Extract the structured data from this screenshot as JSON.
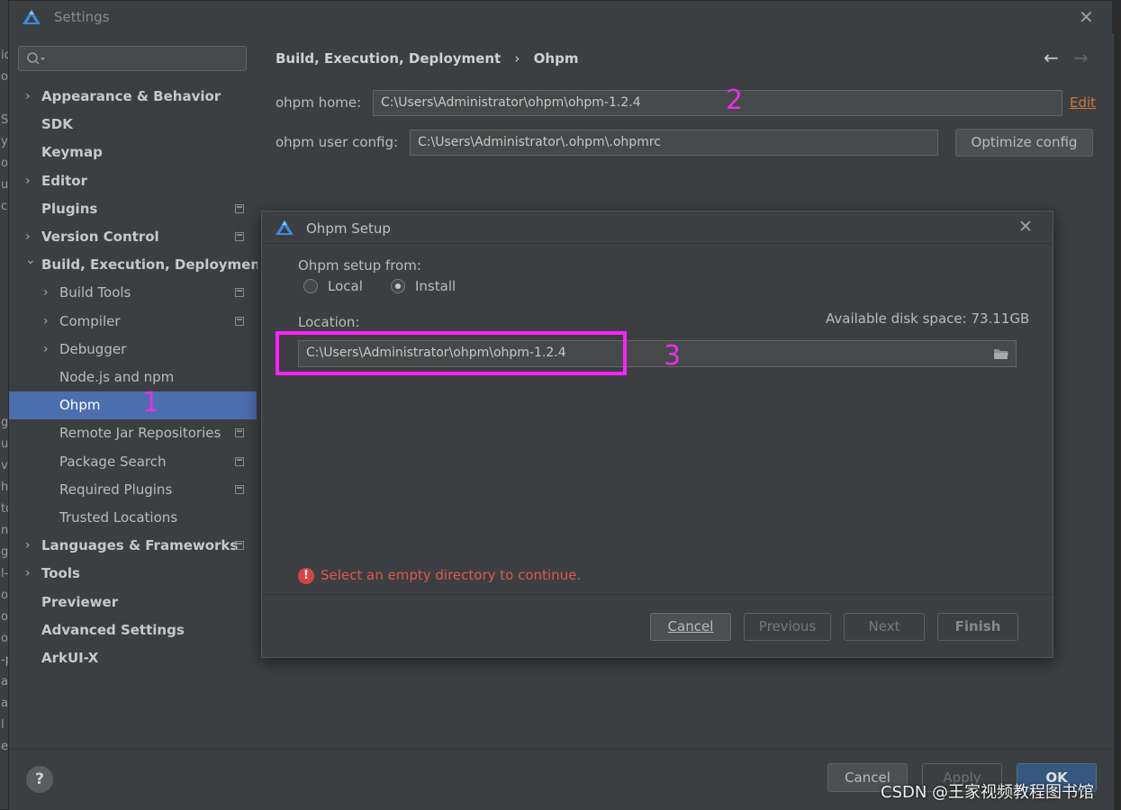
{
  "window": {
    "title": "Settings"
  },
  "background_edge": {
    "fragments": [
      "ic",
      "o",
      "",
      "So",
      "y",
      "or",
      "ui",
      "c",
      "",
      "",
      "",
      "",
      "",
      "",
      "",
      "",
      "",
      "gi",
      "ui",
      "vi",
      "h",
      "to",
      "nc",
      "gi",
      "l-",
      "o",
      "o",
      "o",
      "-p",
      "a",
      "ai",
      "l",
      "es"
    ]
  },
  "sidebar": {
    "search": {
      "placeholder": ""
    },
    "items": [
      {
        "label": "Appearance & Behavior",
        "expandable": true,
        "expanded": false,
        "bold": true,
        "level": 0,
        "marker": false
      },
      {
        "label": "SDK",
        "expandable": false,
        "bold": true,
        "level": 0,
        "marker": false
      },
      {
        "label": "Keymap",
        "expandable": false,
        "bold": true,
        "level": 0,
        "marker": false
      },
      {
        "label": "Editor",
        "expandable": true,
        "expanded": false,
        "bold": true,
        "level": 0,
        "marker": false
      },
      {
        "label": "Plugins",
        "expandable": false,
        "bold": true,
        "level": 0,
        "marker": true
      },
      {
        "label": "Version Control",
        "expandable": true,
        "expanded": false,
        "bold": true,
        "level": 0,
        "marker": true
      },
      {
        "label": "Build, Execution, Deployment",
        "expandable": true,
        "expanded": true,
        "bold": true,
        "level": 0,
        "marker": false
      },
      {
        "label": "Build Tools",
        "expandable": true,
        "expanded": false,
        "bold": false,
        "level": 1,
        "marker": true
      },
      {
        "label": "Compiler",
        "expandable": true,
        "expanded": false,
        "bold": false,
        "level": 1,
        "marker": true
      },
      {
        "label": "Debugger",
        "expandable": true,
        "expanded": false,
        "bold": false,
        "level": 1,
        "marker": false
      },
      {
        "label": "Node.js and npm",
        "expandable": false,
        "bold": false,
        "level": 1,
        "marker": false
      },
      {
        "label": "Ohpm",
        "expandable": false,
        "bold": false,
        "level": 1,
        "marker": false,
        "selected": true
      },
      {
        "label": "Remote Jar Repositories",
        "expandable": false,
        "bold": false,
        "level": 1,
        "marker": true
      },
      {
        "label": "Package Search",
        "expandable": false,
        "bold": false,
        "level": 1,
        "marker": true
      },
      {
        "label": "Required Plugins",
        "expandable": false,
        "bold": false,
        "level": 1,
        "marker": true
      },
      {
        "label": "Trusted Locations",
        "expandable": false,
        "bold": false,
        "level": 1,
        "marker": false
      },
      {
        "label": "Languages & Frameworks",
        "expandable": true,
        "expanded": false,
        "bold": true,
        "level": 0,
        "marker": true
      },
      {
        "label": "Tools",
        "expandable": true,
        "expanded": false,
        "bold": true,
        "level": 0,
        "marker": false
      },
      {
        "label": "Previewer",
        "expandable": false,
        "bold": true,
        "level": 0,
        "marker": false
      },
      {
        "label": "Advanced Settings",
        "expandable": false,
        "bold": true,
        "level": 0,
        "marker": false
      },
      {
        "label": "ArkUI-X",
        "expandable": false,
        "bold": true,
        "level": 0,
        "marker": false
      }
    ]
  },
  "content": {
    "breadcrumb": {
      "parent": "Build, Execution, Deployment",
      "separator": "›",
      "current": "Ohpm"
    },
    "ohpm_home": {
      "label": "ohpm home:",
      "value": "C:\\Users\\Administrator\\ohpm\\ohpm-1.2.4",
      "edit_link": "Edit"
    },
    "user_config": {
      "label": "ohpm user config:",
      "value": "C:\\Users\\Administrator\\.ohpm\\.ohpmrc",
      "button": "Optimize config"
    }
  },
  "dialog": {
    "title": "Ohpm Setup",
    "setup_from_label": "Ohpm setup from:",
    "options": [
      {
        "label": "Local",
        "selected": false
      },
      {
        "label": "Install",
        "selected": true
      }
    ],
    "location_label": "Location:",
    "disk_space": "Available disk space: 73.11GB",
    "location_value": "C:\\Users\\Administrator\\ohpm\\ohpm-1.2.4",
    "error": "Select an empty directory to continue.",
    "buttons": {
      "cancel": "Cancel",
      "previous": "Previous",
      "next": "Next",
      "finish": "Finish"
    }
  },
  "footer": {
    "help": "?",
    "cancel": "Cancel",
    "apply": "Apply",
    "ok": "OK"
  },
  "annotations": {
    "one": "1",
    "two": "2",
    "three": "3"
  },
  "watermark": "CSDN @王家视频教程图书馆",
  "colors": {
    "selection": "#4b6eaf",
    "link": "#cc7832",
    "error": "#e0584f",
    "annotation": "#ff22ff",
    "ok_button": "#365880"
  }
}
